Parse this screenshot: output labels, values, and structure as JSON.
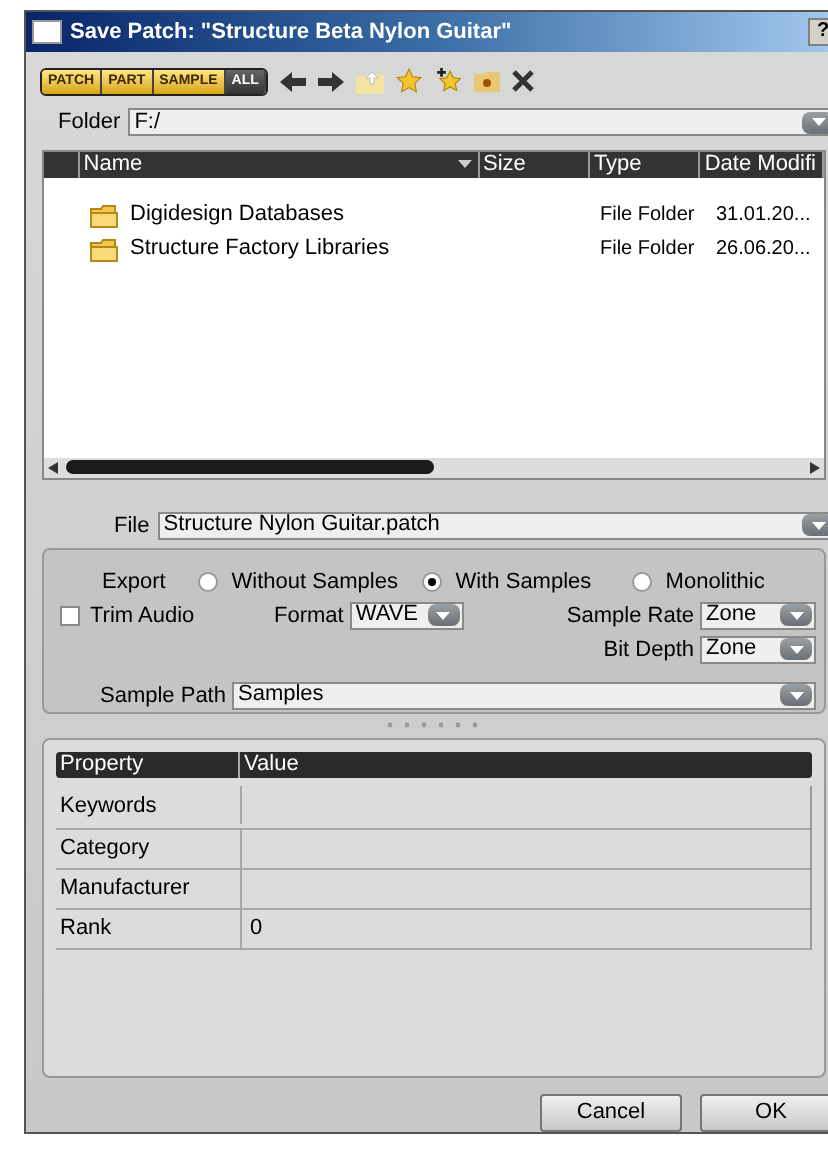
{
  "window": {
    "title": "Save Patch: \"Structure Beta Nylon Guitar\"",
    "help": "?"
  },
  "filters": [
    {
      "label": "PATCH",
      "selected": true
    },
    {
      "label": "PART",
      "selected": true
    },
    {
      "label": "SAMPLE",
      "selected": true
    },
    {
      "label": "ALL",
      "selected": false
    }
  ],
  "folder": {
    "label": "Folder",
    "value": "F:/"
  },
  "file_list": {
    "columns": [
      "Name",
      "Size",
      "Type",
      "Date Modifi"
    ],
    "rows": [
      {
        "name": "Digidesign Databases",
        "size": "",
        "type": "File Folder",
        "date": "31.01.20..."
      },
      {
        "name": "Structure Factory Libraries",
        "size": "",
        "type": "File Folder",
        "date": "26.06.20..."
      }
    ]
  },
  "file": {
    "label": "File",
    "value": "Structure Nylon Guitar.patch"
  },
  "export": {
    "label": "Export",
    "options": [
      {
        "label": "Without Samples",
        "selected": false
      },
      {
        "label": "With Samples",
        "selected": true
      },
      {
        "label": "Monolithic",
        "selected": false
      }
    ]
  },
  "trim_audio": {
    "label": "Trim Audio",
    "checked": false
  },
  "format": {
    "label": "Format",
    "value": "WAVE"
  },
  "sample_rate": {
    "label": "Sample Rate",
    "value": "Zone"
  },
  "bit_depth": {
    "label": "Bit Depth",
    "value": "Zone"
  },
  "sample_path": {
    "label": "Sample Path",
    "value": "Samples"
  },
  "properties": {
    "columns": [
      "Property",
      "Value"
    ],
    "rows": [
      {
        "property": "Keywords",
        "value": ""
      },
      {
        "property": "Category",
        "value": ""
      },
      {
        "property": "Manufacturer",
        "value": ""
      },
      {
        "property": "Rank",
        "value": "0"
      }
    ]
  },
  "buttons": [
    "Cancel",
    "OK"
  ]
}
